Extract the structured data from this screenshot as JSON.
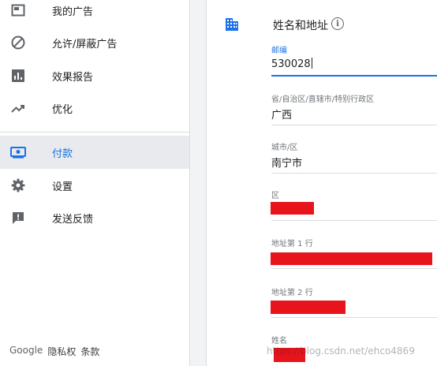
{
  "sidebar": {
    "items": [
      {
        "label": "我的广告",
        "icon": "ads-icon"
      },
      {
        "label": "允许/屏蔽广告",
        "icon": "block-icon"
      },
      {
        "label": "效果报告",
        "icon": "bar-chart-icon"
      },
      {
        "label": "优化",
        "icon": "trending-up-icon"
      },
      {
        "label": "付款",
        "icon": "payments-icon",
        "active": true
      },
      {
        "label": "设置",
        "icon": "gear-icon"
      },
      {
        "label": "发送反馈",
        "icon": "feedback-icon"
      }
    ],
    "active_color": "#1a73e8"
  },
  "footer": {
    "brand": "Google",
    "privacy": "隐私权",
    "terms": "条款"
  },
  "section": {
    "title": "姓名和地址",
    "info": "i"
  },
  "fields": {
    "postal": {
      "label": "邮编",
      "value": "530028"
    },
    "province": {
      "label": "省/自治区/直辖市/特别行政区",
      "value": "广西"
    },
    "city": {
      "label": "城市/区",
      "value": "南宁市"
    },
    "district": {
      "label": "区",
      "value": ""
    },
    "address1": {
      "label": "地址第 1 行",
      "value": ""
    },
    "address2": {
      "label": "地址第 2 行",
      "value": ""
    },
    "name": {
      "label": "姓名",
      "value": ""
    }
  },
  "watermark": "https://blog.csdn.net/ehco4869",
  "redaction_color": "#e8141c"
}
